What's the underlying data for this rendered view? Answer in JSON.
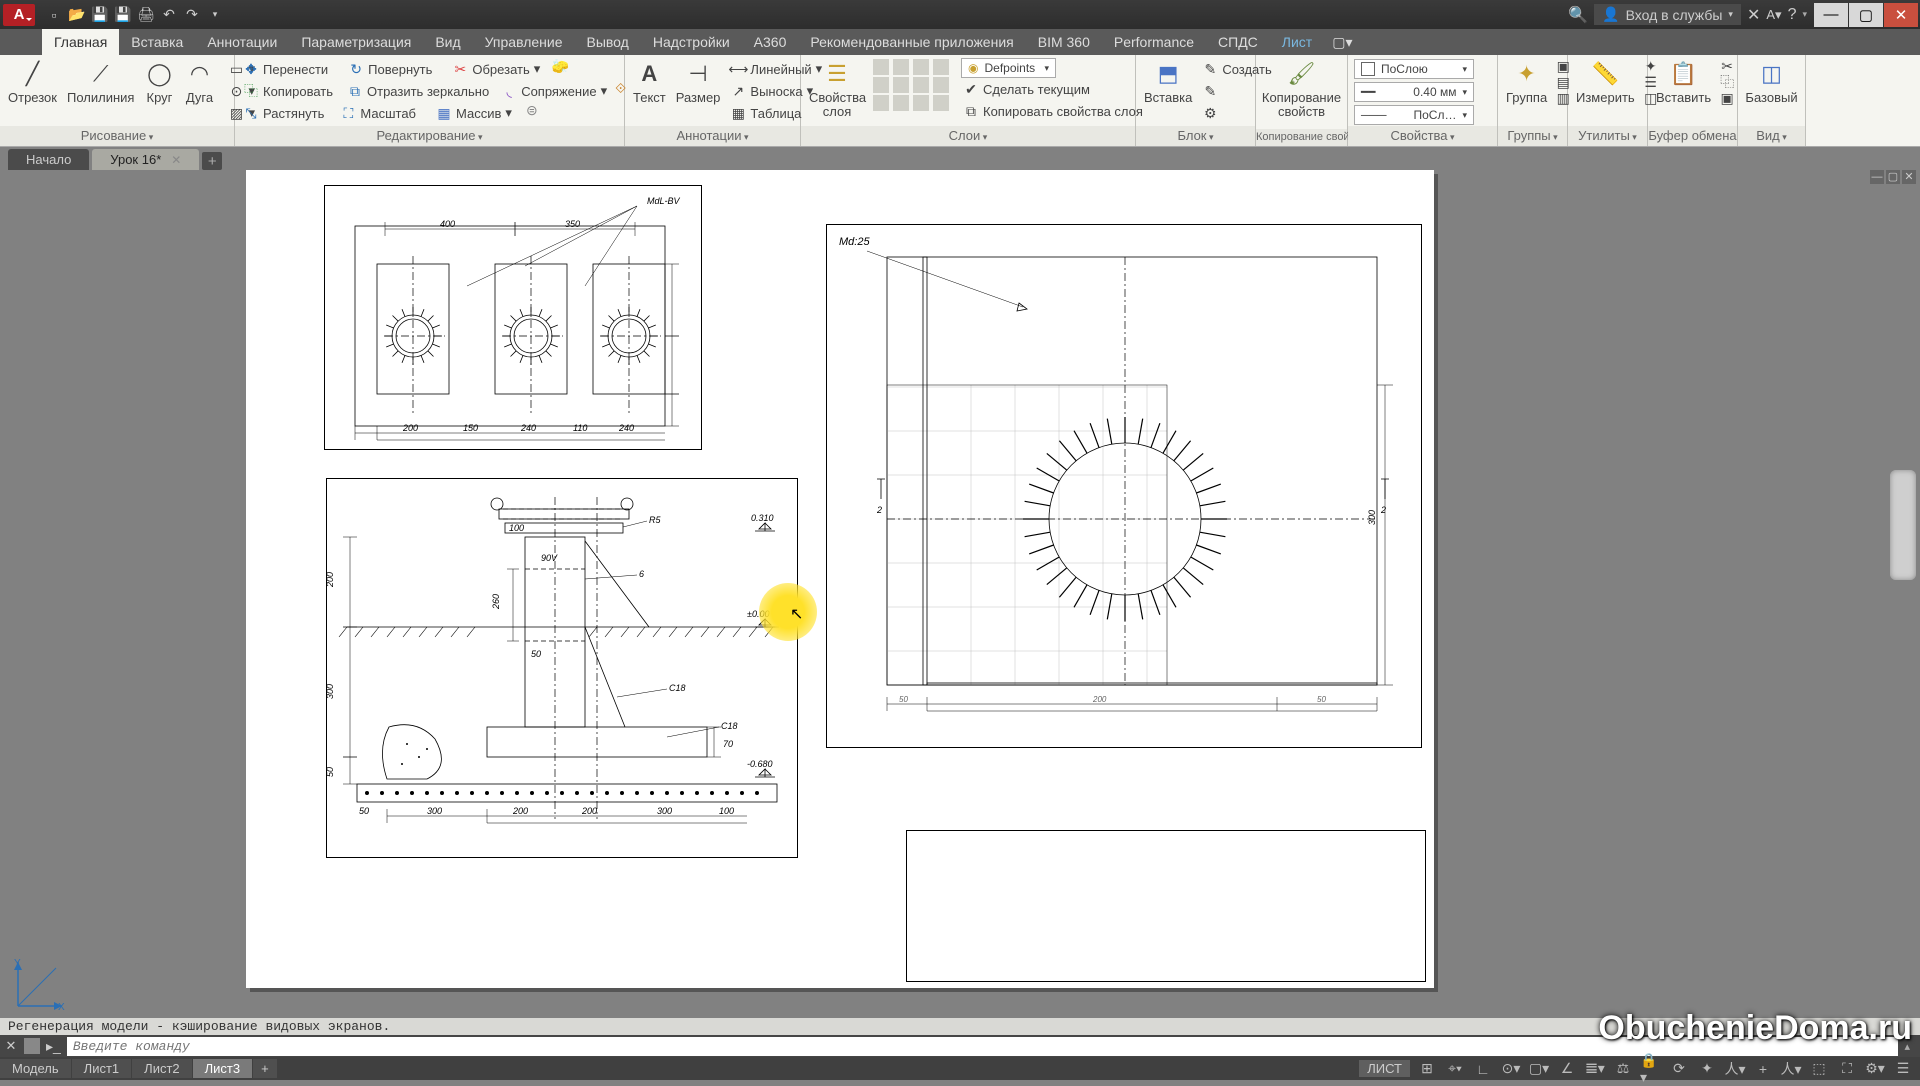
{
  "title_right": {
    "login": "Вход в службы",
    "signin_icon": "👤"
  },
  "qat": [
    "new",
    "open",
    "save",
    "save-as",
    "print",
    "undo",
    "redo"
  ],
  "tabs": [
    "Главная",
    "Вставка",
    "Аннотации",
    "Параметризация",
    "Вид",
    "Управление",
    "Вывод",
    "Надстройки",
    "A360",
    "Рекомендованные приложения",
    "BIM 360",
    "Performance",
    "СПДС",
    "Лист"
  ],
  "active_tab": "Главная",
  "ribbon": {
    "draw": {
      "title": "Рисование",
      "items": [
        "Отрезок",
        "Полилиния",
        "Круг",
        "Дуга"
      ]
    },
    "modify": {
      "title": "Редактирование",
      "rows": [
        [
          "Перенести",
          "Повернуть",
          "Обрезать"
        ],
        [
          "Копировать",
          "Отразить зеркально",
          "Сопряжение"
        ],
        [
          "Растянуть",
          "Масштаб",
          "Массив"
        ]
      ]
    },
    "annot": {
      "title": "Аннотации",
      "text": "Текст",
      "dim": "Размер",
      "rows": [
        "Линейный",
        "Выноска",
        "Таблица"
      ]
    },
    "layers": {
      "title": "Слои",
      "props": "Свойства слоя",
      "cur": "Defpoints",
      "btns": [
        "Сделать текущим",
        "Копировать свойства слоя"
      ]
    },
    "block": {
      "title": "Блок",
      "ins": "Вставка",
      "create": "Создать"
    },
    "clip": {
      "title": "Копирование свойств",
      "label": "Копирование свойств"
    },
    "props": {
      "title": "Свойства",
      "bylayer": "ПоСлою",
      "lw": "0.40 мм",
      "lt": "ПоСл…"
    },
    "groups": {
      "title": "Группы",
      "label": "Группа"
    },
    "utils": {
      "title": "Утилиты",
      "label": "Измерить"
    },
    "cb": {
      "title": "Буфер обмена",
      "label": "Вставить"
    },
    "view": {
      "title": "Вид",
      "label": "Базовый"
    }
  },
  "doctabs": {
    "start": "Начало",
    "file": "Урок 16*"
  },
  "cmd": {
    "hist": "Регенерация модели - кэширование видовых экранов.",
    "ph": "Введите команду"
  },
  "layouts": [
    "Модель",
    "Лист1",
    "Лист2",
    "Лист3"
  ],
  "active_layout": "Лист3",
  "status_mode": "ЛИСТ",
  "watermark": "ObuchenieDoma.ru",
  "drawing": {
    "top_left_label": "МdL-ВV",
    "dims_top": [
      "400",
      "350"
    ],
    "dims_bot": [
      "200",
      "150",
      "240",
      "110",
      "240"
    ],
    "right_label": "Мd:25",
    "right_dims": [
      "50",
      "200",
      "50"
    ],
    "right_v": "300",
    "sec_dims": [
      "300",
      "200",
      "200",
      "300"
    ],
    "sec_v": [
      "200",
      "300",
      "50"
    ],
    "sec_lvl": [
      "0.310",
      "±0.00",
      "-0.680"
    ],
    "sec_call": [
      "С18",
      "С18"
    ]
  }
}
